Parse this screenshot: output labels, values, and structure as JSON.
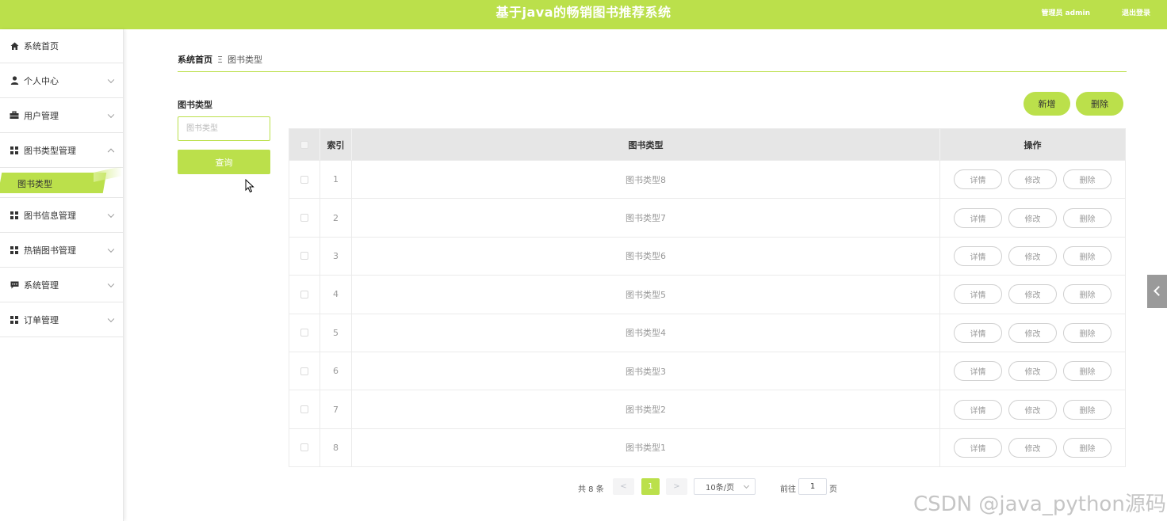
{
  "header": {
    "title": "基于java的畅销图书推荐系统",
    "user": "管理员 admin",
    "logout": "退出登录"
  },
  "sidebar": {
    "items": [
      {
        "label": "系统首页",
        "icon": "home-icon"
      },
      {
        "label": "个人中心",
        "icon": "user-icon"
      },
      {
        "label": "用户管理",
        "icon": "briefcase-icon"
      },
      {
        "label": "图书类型管理",
        "icon": "grid-icon",
        "expanded": true
      },
      {
        "label": "图书信息管理",
        "icon": "grid-icon"
      },
      {
        "label": "热销图书管理",
        "icon": "grid-icon"
      },
      {
        "label": "系统管理",
        "icon": "message-icon"
      },
      {
        "label": "订单管理",
        "icon": "grid-icon"
      }
    ],
    "submenu": {
      "label": "图书类型"
    }
  },
  "breadcrumb": {
    "home": "系统首页",
    "sep": "Ξ",
    "current": "图书类型"
  },
  "search": {
    "label": "图书类型",
    "placeholder": "图书类型",
    "button": "查询"
  },
  "actions": {
    "add": "新增",
    "delete": "删除"
  },
  "table": {
    "headers": {
      "index": "索引",
      "name": "图书类型",
      "ops": "操作"
    },
    "ops": {
      "detail": "详情",
      "edit": "修改",
      "delete": "删除"
    },
    "rows": [
      {
        "index": "1",
        "name": "图书类型8"
      },
      {
        "index": "2",
        "name": "图书类型7"
      },
      {
        "index": "3",
        "name": "图书类型6"
      },
      {
        "index": "4",
        "name": "图书类型5"
      },
      {
        "index": "5",
        "name": "图书类型4"
      },
      {
        "index": "6",
        "name": "图书类型3"
      },
      {
        "index": "7",
        "name": "图书类型2"
      },
      {
        "index": "8",
        "name": "图书类型1"
      }
    ]
  },
  "pagination": {
    "total": "共 8 条",
    "prev": "<",
    "page": "1",
    "next": ">",
    "page_size": "10条/页",
    "goto": "前往",
    "jump_value": "1",
    "unit": "页"
  },
  "watermark": "CSDN @java_python源码",
  "colors": {
    "accent": "#bbe04b"
  }
}
